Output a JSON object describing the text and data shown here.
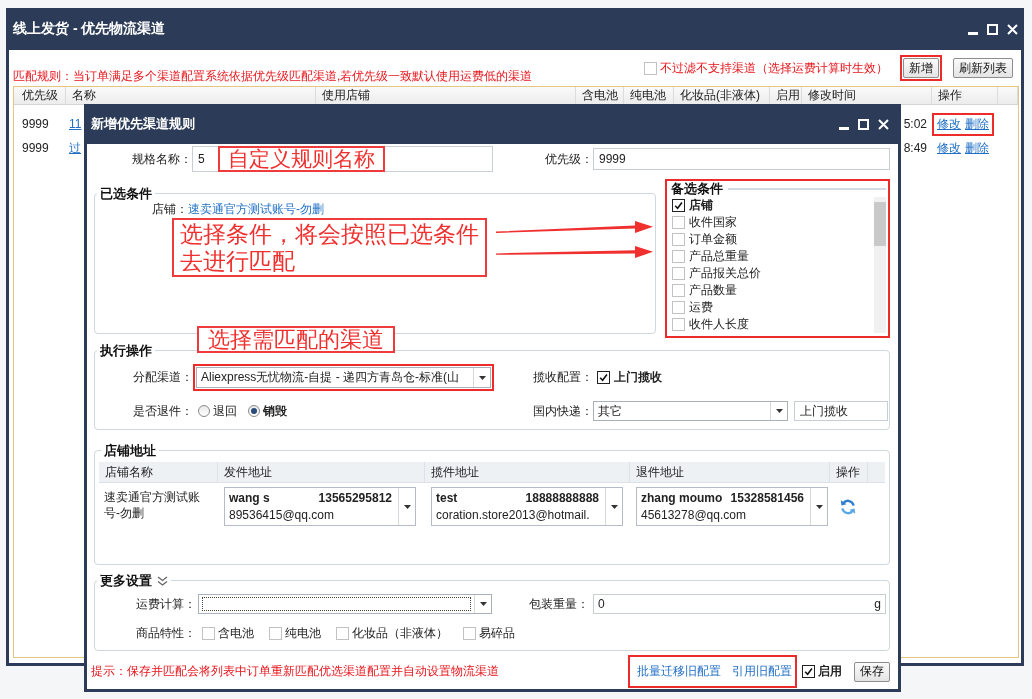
{
  "window": {
    "title": "线上发货 - 优先物流渠道"
  },
  "notice": "匹配规则：当订单满足多个渠道配置系统依据优先级匹配渠道,若优先级一致默认使用运费低的渠道",
  "filter": {
    "label": "不过滤不支持渠道（选择运费计算时生效）",
    "checked": false
  },
  "toolbar_buttons": [
    {
      "label": "新增",
      "highlighted": true
    },
    {
      "label": "刷新列表",
      "highlighted": false
    }
  ],
  "table": {
    "columns": [
      "优先级",
      "名称",
      "使用店铺",
      "含电池",
      "纯电池",
      "化妆品(非液体)",
      "启用",
      "修改时间",
      "操作"
    ],
    "rows": [
      {
        "priority": "9999",
        "name": "11",
        "modified": "5:02",
        "actions": [
          "修改",
          "删除"
        ],
        "highlighted": true
      },
      {
        "priority": "9999",
        "name": "过",
        "modified": "8:49",
        "actions": [
          "修改",
          "删除"
        ],
        "highlighted": false
      }
    ]
  },
  "dialog": {
    "title": "新增优先渠道规则",
    "name_field": {
      "label": "规格名称：",
      "value": "5",
      "annotation": "自定义规则名称"
    },
    "priority_field": {
      "label": "优先级：",
      "value": "9999"
    },
    "selected_conditions": {
      "title": "已选条件",
      "items": [
        {
          "label": "店铺：",
          "value": "速卖通官方测试账号-勿删"
        }
      ],
      "annotation": "选择条件，将会按照已选条件去进行匹配"
    },
    "candidate_conditions": {
      "title": "备选条件",
      "highlighted": true,
      "items": [
        {
          "label": "店铺",
          "checked": true
        },
        {
          "label": "收件国家",
          "checked": false
        },
        {
          "label": "订单金额",
          "checked": false
        },
        {
          "label": "产品总重量",
          "checked": false
        },
        {
          "label": "产品报关总价",
          "checked": false
        },
        {
          "label": "产品数量",
          "checked": false
        },
        {
          "label": "运费",
          "checked": false
        },
        {
          "label": "收件人长度",
          "checked": false
        }
      ]
    },
    "execution": {
      "title": "执行操作",
      "annotation": "选择需匹配的渠道",
      "channel": {
        "label": "分配渠道：",
        "value": "Aliexpress无忧物流-自提 - 递四方青岛仓-标准(山",
        "highlighted": true
      },
      "pickup": {
        "label": "揽收配置：",
        "option": "上门揽收",
        "checked": true
      },
      "return": {
        "label": "是否退件：",
        "options": [
          {
            "label": "退回",
            "selected": false
          },
          {
            "label": "销毁",
            "selected": true
          }
        ]
      },
      "courier": {
        "label": "国内快递：",
        "value": "其它",
        "method": "上门揽收"
      }
    },
    "store_address": {
      "title": "店铺地址",
      "columns": [
        "店铺名称",
        "发件地址",
        "揽件地址",
        "退件地址",
        "操作"
      ],
      "rows": [
        {
          "store": "速卖通官方测试账号-勿删",
          "addresses": [
            {
              "name": "wang s",
              "phone": "13565295812",
              "email": "89536415@qq.com"
            },
            {
              "name": "test",
              "phone": "18888888888",
              "email": "coration.store2013@hotmail."
            },
            {
              "name": "zhang moumo",
              "phone": "15328581456",
              "email": "45613278@qq.com"
            }
          ]
        }
      ]
    },
    "more_settings": {
      "title": "更多设置",
      "freight": {
        "label": "运费计算："
      },
      "weight": {
        "label": "包装重量：",
        "value": "0",
        "unit": "g"
      },
      "features": {
        "label": "商品特性：",
        "options": [
          {
            "label": "含电池",
            "checked": false
          },
          {
            "label": "纯电池",
            "checked": false
          },
          {
            "label": "化妆品（非液体）",
            "checked": false
          },
          {
            "label": "易碎品",
            "checked": false
          }
        ]
      }
    },
    "footer": {
      "hint": "提示：保存并匹配会将列表中订单重新匹配优选渠道配置并自动设置物流渠道",
      "links": [
        "批量迁移旧配置",
        "引用旧配置"
      ],
      "links_highlighted": true,
      "enabled": {
        "label": "启用",
        "checked": true
      },
      "save": "保存"
    }
  }
}
